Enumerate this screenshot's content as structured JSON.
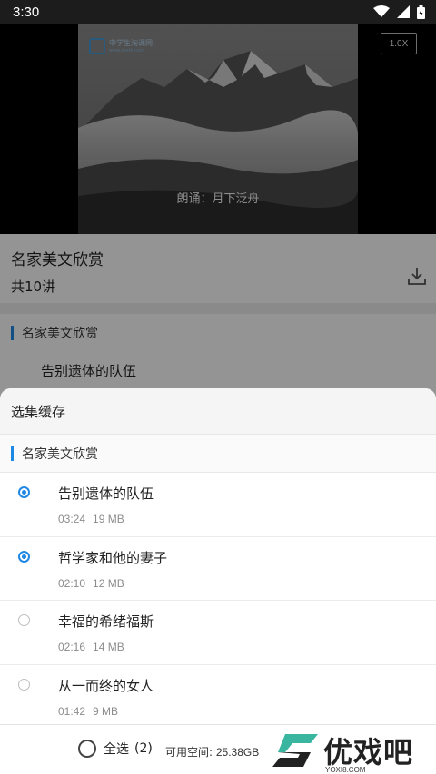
{
  "status_bar": {
    "time": "3:30",
    "icons": [
      "wifi-icon",
      "signal-icon",
      "battery-icon"
    ]
  },
  "video": {
    "speed_label": "1.0X",
    "logo_text": "中学生淘课网",
    "logo_url": "www.zxstk.com",
    "subtitle": "朗诵：月下泛舟"
  },
  "course": {
    "title": "名家美文欣赏",
    "count": "共10讲",
    "section_title": "名家美文欣赏",
    "first_item": "告别遗体的队伍"
  },
  "sheet": {
    "title": "选集缓存",
    "section_title": "名家美文欣赏",
    "episodes": [
      {
        "title": "告别遗体的队伍",
        "duration": "03:24",
        "size": "19 MB",
        "selected": true
      },
      {
        "title": "哲学家和他的妻子",
        "duration": "02:10",
        "size": "12 MB",
        "selected": true
      },
      {
        "title": "幸福的希绪福斯",
        "duration": "02:16",
        "size": "14 MB",
        "selected": false
      },
      {
        "title": "从一而终的女人",
        "duration": "01:42",
        "size": "9 MB",
        "selected": false
      }
    ],
    "footer": {
      "select_all": "全选",
      "selected_count": "(2)",
      "storage_label": "可用空间:",
      "storage_value": "25.38GB"
    }
  },
  "watermark": {
    "text": "优戏吧",
    "url": "YOXI8.COM"
  },
  "colors": {
    "accent": "#1e88e5",
    "status_bar": "#1c1c1c"
  }
}
